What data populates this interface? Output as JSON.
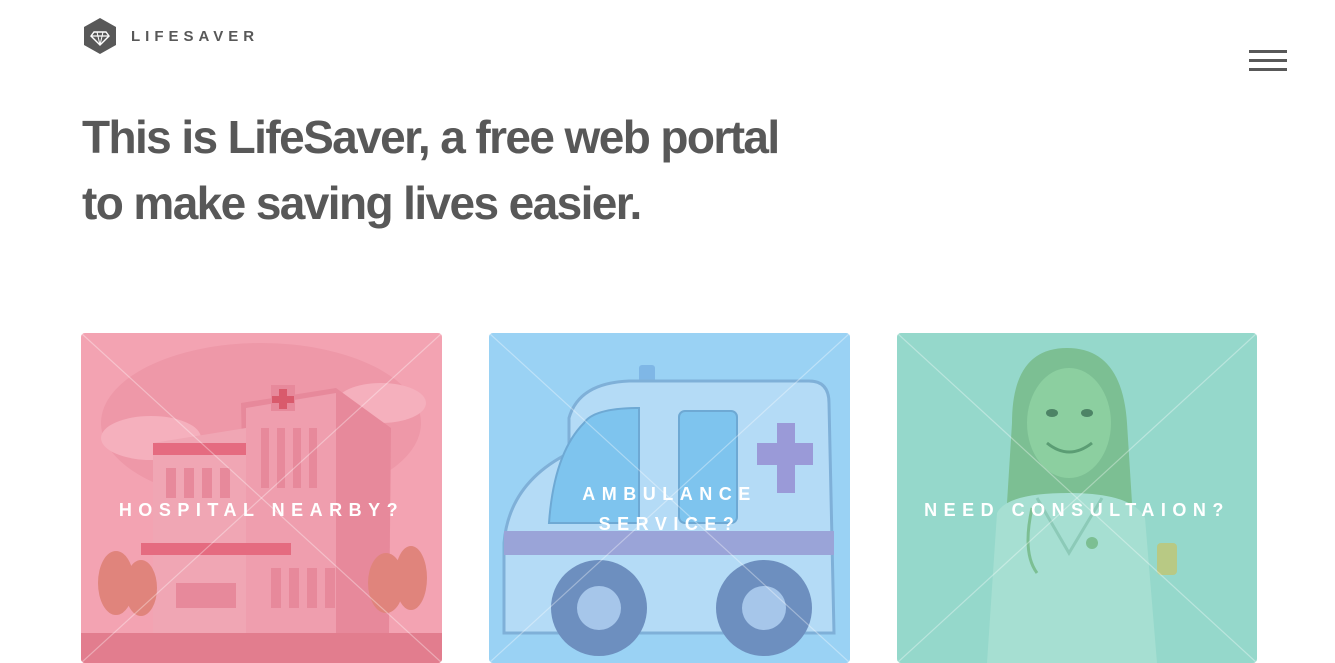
{
  "header": {
    "brand": "LIFESAVER",
    "logo_icon": "diamond-hexagon-icon",
    "menu_icon": "hamburger-menu-icon"
  },
  "hero": {
    "line1": "This is LifeSaver, a free web portal",
    "line2": "to make saving lives easier."
  },
  "tiles": [
    {
      "title": "HOSPITAL NEARBY?",
      "icon": "hospital-illustration",
      "color": "#f3a3b2"
    },
    {
      "title_line1": "AMBULANCE",
      "title_line2": "SERVICE?",
      "icon": "ambulance-illustration",
      "color": "#9ad2f4"
    },
    {
      "title": "NEED CONSULTAION?",
      "icon": "doctor-illustration",
      "color": "#95d8cb"
    }
  ],
  "colors": {
    "text": "#585858",
    "background": "#ffffff"
  }
}
